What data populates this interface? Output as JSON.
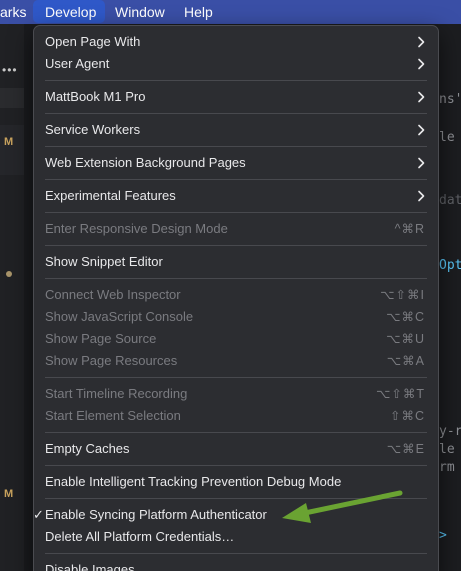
{
  "menubar": {
    "items": [
      {
        "label": "arks"
      },
      {
        "label": "Develop"
      },
      {
        "label": "Window"
      },
      {
        "label": "Help"
      }
    ]
  },
  "background": {
    "dots": "•••",
    "badge1": "M",
    "badge2": "M",
    "right_lines": [
      "ns'",
      "le",
      "dat",
      "Opt",
      "y-r",
      "le",
      "rm",
      ">"
    ]
  },
  "menu": {
    "open_page_with": "Open Page With",
    "user_agent": "User Agent",
    "device": "MattBook M1 Pro",
    "service_workers": "Service Workers",
    "web_ext_bg_pages": "Web Extension Background Pages",
    "experimental_features": "Experimental Features",
    "responsive_design": "Enter Responsive Design Mode",
    "responsive_design_sc": "^⌘R",
    "snippet_editor": "Show Snippet Editor",
    "connect_inspector": "Connect Web Inspector",
    "connect_inspector_sc": "⌥⇧⌘I",
    "js_console": "Show JavaScript Console",
    "js_console_sc": "⌥⌘C",
    "page_source": "Show Page Source",
    "page_source_sc": "⌥⌘U",
    "page_resources": "Show Page Resources",
    "page_resources_sc": "⌥⌘A",
    "timeline_recording": "Start Timeline Recording",
    "timeline_recording_sc": "⌥⇧⌘T",
    "element_selection": "Start Element Selection",
    "element_selection_sc": "⇧⌘C",
    "empty_caches": "Empty Caches",
    "empty_caches_sc": "⌥⌘E",
    "itp_debug": "Enable Intelligent Tracking Prevention Debug Mode",
    "check_mark": "✓",
    "syncing_auth": "Enable Syncing Platform Authenticator",
    "delete_credentials": "Delete All Platform Credentials…",
    "disable_images": "Disable Images"
  },
  "colors": {
    "menubar_bg": "#3a4fa6",
    "menubar_active": "#2f58c8",
    "menu_bg": "#2c2d31",
    "annotation_arrow": "#6aa332"
  }
}
